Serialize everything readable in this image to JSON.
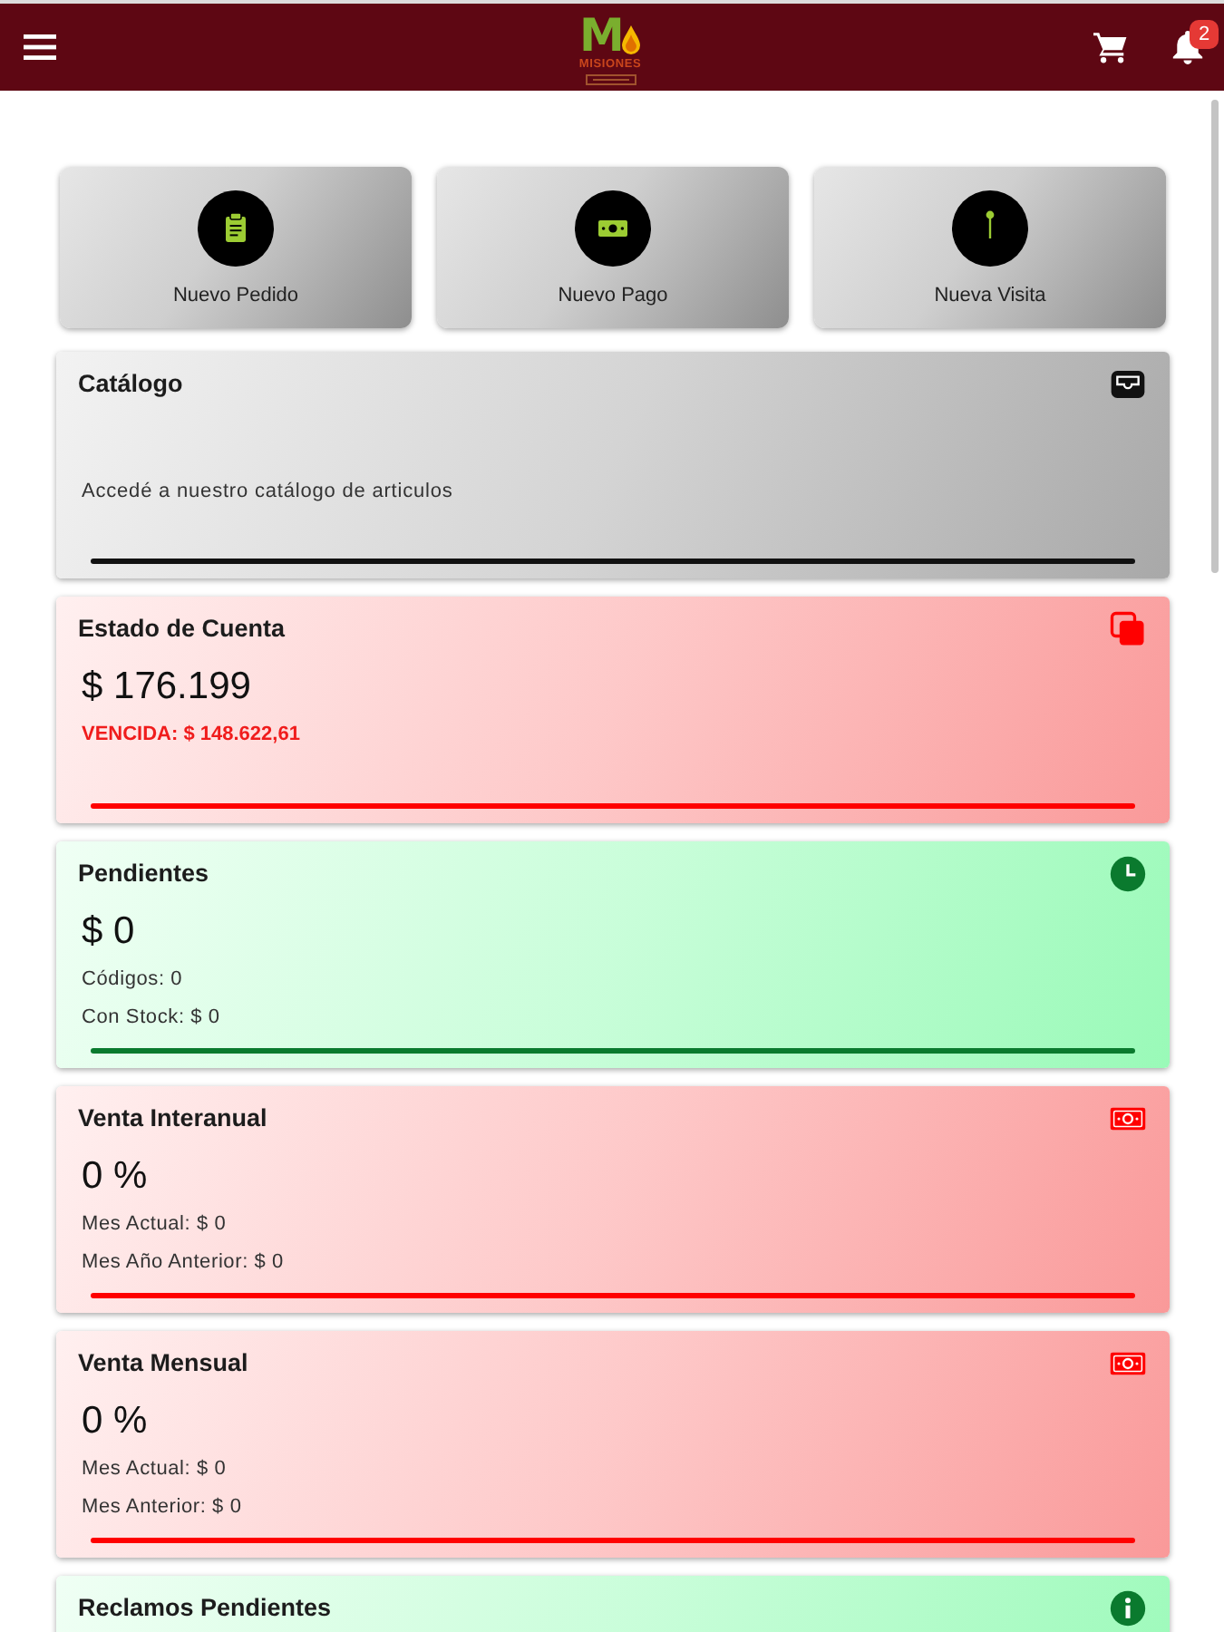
{
  "header": {
    "logo": {
      "mark": "M",
      "wordmark": "MISIONES"
    },
    "notification_count": "2"
  },
  "quick_actions": [
    {
      "kind": "order",
      "label": "Nuevo Pedido"
    },
    {
      "kind": "payment",
      "label": "Nuevo Pago"
    },
    {
      "kind": "visit",
      "label": "Nueva Visita"
    }
  ],
  "cards": [
    {
      "kind": "catalog",
      "color": "#111111",
      "title": "Catálogo",
      "description": "Accedé a nuestro catálogo de articulos"
    },
    {
      "kind": "account",
      "color": "#ff0000",
      "title": "Estado de Cuenta",
      "amount": "$ 176.199",
      "details": [
        {
          "text": "VENCIDA: $ 148.622,61",
          "alert": true
        }
      ]
    },
    {
      "kind": "pending",
      "color": "#0a7a2e",
      "title": "Pendientes",
      "amount": "$ 0",
      "details": [
        {
          "text": "Códigos: 0",
          "alert": false
        },
        {
          "text": "Con Stock: $ 0",
          "alert": false
        }
      ]
    },
    {
      "kind": "sales",
      "color": "#ff0000",
      "title": "Venta Interanual",
      "amount": "0 %",
      "details": [
        {
          "text": "Mes Actual: $ 0",
          "alert": false
        },
        {
          "text": "Mes Año Anterior: $ 0",
          "alert": false
        }
      ]
    },
    {
      "kind": "sales",
      "color": "#ff0000",
      "title": "Venta Mensual",
      "amount": "0 %",
      "details": [
        {
          "text": "Mes Actual: $ 0",
          "alert": false
        },
        {
          "text": "Mes Anterior: $ 0",
          "alert": false
        }
      ]
    },
    {
      "kind": "claims",
      "color": "#0a7a2e",
      "title": "Reclamos Pendientes"
    }
  ]
}
